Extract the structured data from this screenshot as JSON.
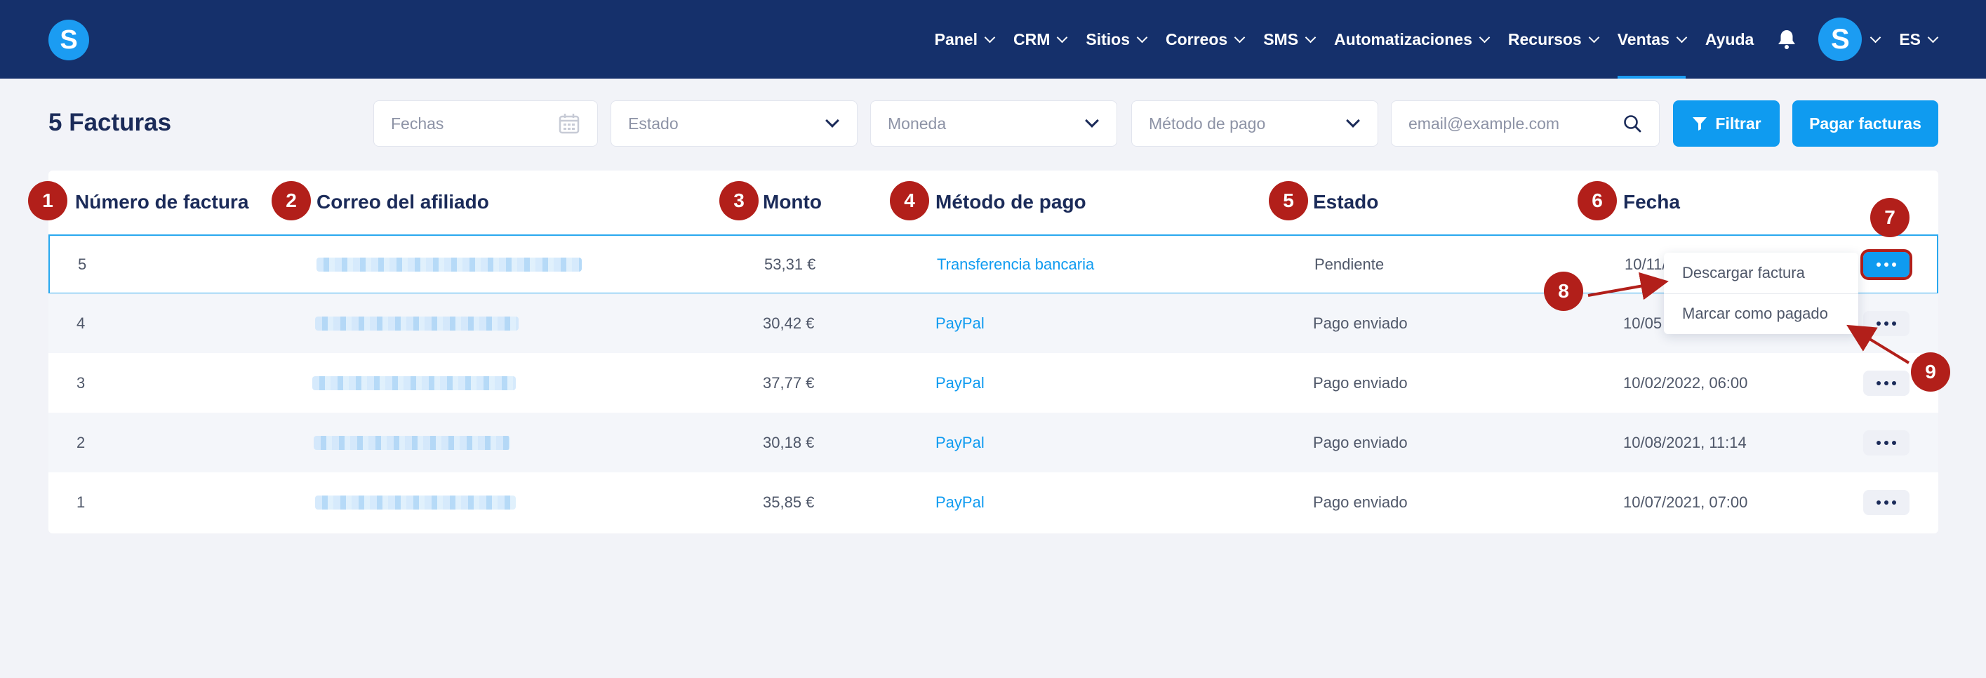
{
  "nav": {
    "logo": "S",
    "items": [
      {
        "label": "Panel"
      },
      {
        "label": "CRM"
      },
      {
        "label": "Sitios"
      },
      {
        "label": "Correos"
      },
      {
        "label": "SMS"
      },
      {
        "label": "Automatizaciones"
      },
      {
        "label": "Recursos"
      },
      {
        "label": "Ventas"
      }
    ],
    "help": "Ayuda",
    "avatar": "S",
    "language": "ES",
    "active": "Ventas"
  },
  "toolbar": {
    "title": "5 Facturas",
    "dates_placeholder": "Fechas",
    "status_placeholder": "Estado",
    "currency_placeholder": "Moneda",
    "payment_placeholder": "Método de pago",
    "email_placeholder": "email@example.com",
    "filter_label": "Filtrar",
    "pay_label": "Pagar facturas"
  },
  "table": {
    "headers": {
      "number": "Número de factura",
      "email": "Correo del afiliado",
      "amount": "Monto",
      "method": "Método de pago",
      "status": "Estado",
      "date": "Fecha"
    },
    "rows": [
      {
        "number": "5",
        "amount": "53,31 €",
        "method": "Transferencia bancaria",
        "status": "Pendiente",
        "date": "10/11/"
      },
      {
        "number": "4",
        "amount": "30,42 €",
        "method": "PayPal",
        "status": "Pago enviado",
        "date": "10/05"
      },
      {
        "number": "3",
        "amount": "37,77 €",
        "method": "PayPal",
        "status": "Pago enviado",
        "date": "10/02/2022, 06:00"
      },
      {
        "number": "2",
        "amount": "30,18 €",
        "method": "PayPal",
        "status": "Pago enviado",
        "date": "10/08/2021, 11:14"
      },
      {
        "number": "1",
        "amount": "35,85 €",
        "method": "PayPal",
        "status": "Pago enviado",
        "date": "10/07/2021, 07:00"
      }
    ]
  },
  "menu": {
    "download": "Descargar factura",
    "mark_paid": "Marcar como pagado"
  },
  "badges": [
    "1",
    "2",
    "3",
    "4",
    "5",
    "6",
    "7",
    "8",
    "9"
  ],
  "colors": {
    "nav_bg": "#15306b",
    "accent": "#0f9bf0",
    "badge": "#b21f1a"
  }
}
